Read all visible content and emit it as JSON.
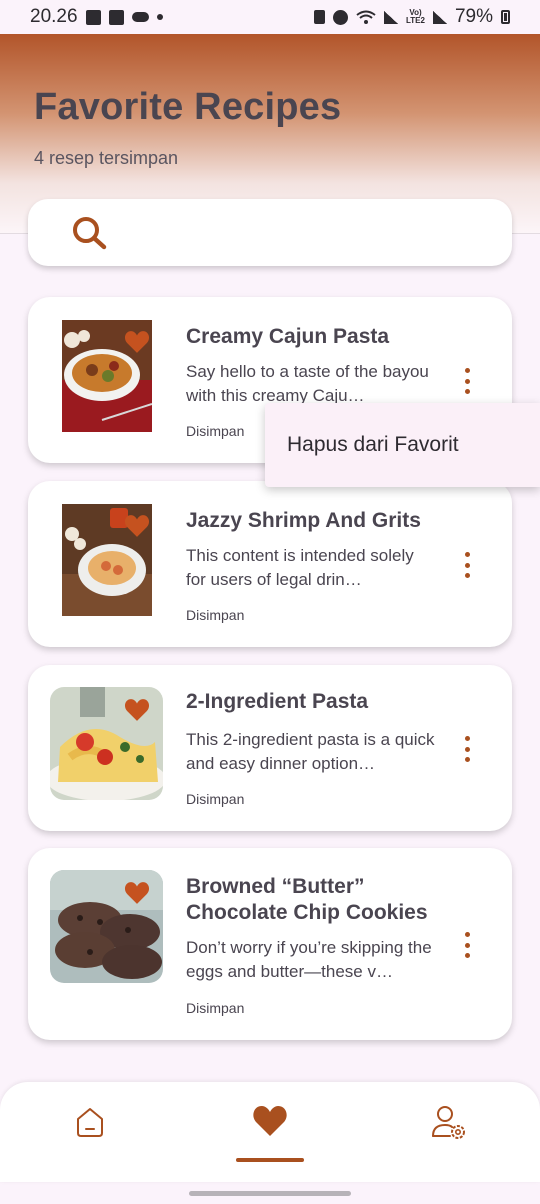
{
  "status_bar": {
    "time": "20.26",
    "battery": "79%"
  },
  "header": {
    "title": "Favorite Recipes",
    "subtitle": "4 resep tersimpan"
  },
  "search": {
    "icon": "search-icon",
    "value": ""
  },
  "cards": [
    {
      "title": "Creamy Cajun Pasta",
      "description": "Say hello to a taste of the bayou with this creamy Caju…",
      "meta": "Disimpan",
      "favorited": true
    },
    {
      "title": "Jazzy Shrimp And Grits",
      "description": "This content is intended solely for users of legal drin…",
      "meta": "Disimpan",
      "favorited": true
    },
    {
      "title": "2-Ingredient Pasta",
      "description": "This 2-ingredient pasta is a quick and easy dinner option…",
      "meta": "Disimpan",
      "favorited": true
    },
    {
      "title": "Browned “Butter” Chocolate Chip Cookies",
      "description": "Don’t worry if you’re skipping the eggs and butter—these v…",
      "meta": "Disimpan",
      "favorited": true
    }
  ],
  "popup_menu": {
    "items": [
      "Hapus dari Favorit"
    ]
  },
  "bottom_nav": {
    "items": [
      {
        "name": "home",
        "icon": "home-icon",
        "active": false
      },
      {
        "name": "favorites",
        "icon": "heart-icon",
        "active": true
      },
      {
        "name": "profile-settings",
        "icon": "user-settings-icon",
        "active": false
      }
    ]
  },
  "colors": {
    "accent": "#a9501f",
    "header_top": "#b2552a",
    "background": "#fbf3fb",
    "card": "#ffffff",
    "text": "#4a4550"
  }
}
